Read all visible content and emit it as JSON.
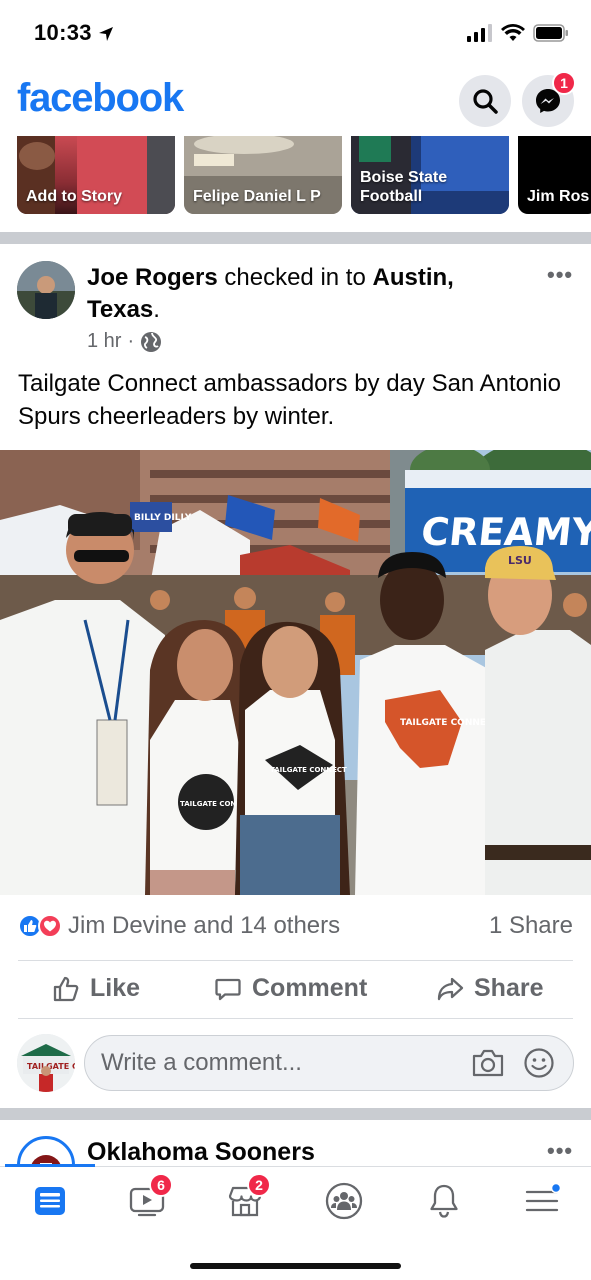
{
  "status_bar": {
    "time": "10:33"
  },
  "header": {
    "logo": "facebook",
    "messenger_badge": "1",
    "search_icon": "search-icon",
    "messenger_icon": "messenger-icon"
  },
  "stories": [
    {
      "label": "Add to Story"
    },
    {
      "label": "Felipe Daniel L P"
    },
    {
      "label": "Boise State Football"
    },
    {
      "label": "Jim Ros"
    }
  ],
  "post": {
    "author": "Joe Rogers",
    "verb": "checked in to",
    "place": "Austin, Texas",
    "period": ".",
    "time": "1 hr",
    "dot": "·",
    "privacy_icon": "globe-icon",
    "body": "Tailgate Connect ambassadors by day San Antonio Spurs cheerleaders by winter.",
    "photo": {
      "banner": "CREAMY HO",
      "flag_text": "BILLY DILLY",
      "shirt_text": "TAILGATE CONNECT",
      "shirt_text_2": "TAILGATE CONNECT",
      "texas_shirt": "TAILGATE CONNECT",
      "cap_text": "LSU"
    },
    "reactions_text": "Jim Devine and 14 others",
    "shares_text": "1 Share",
    "actions": {
      "like": "Like",
      "comment": "Comment",
      "share": "Share"
    },
    "comment_placeholder": "Write a comment...",
    "comment_avatar_text": "TAILGATE C"
  },
  "next_post": {
    "title": "Oklahoma Sooners"
  },
  "bottom_nav": {
    "video_badge": "6",
    "marketplace_badge": "2"
  },
  "colors": {
    "brand": "#1877f2",
    "badge": "#f02849",
    "secondary_text": "#65676b"
  }
}
